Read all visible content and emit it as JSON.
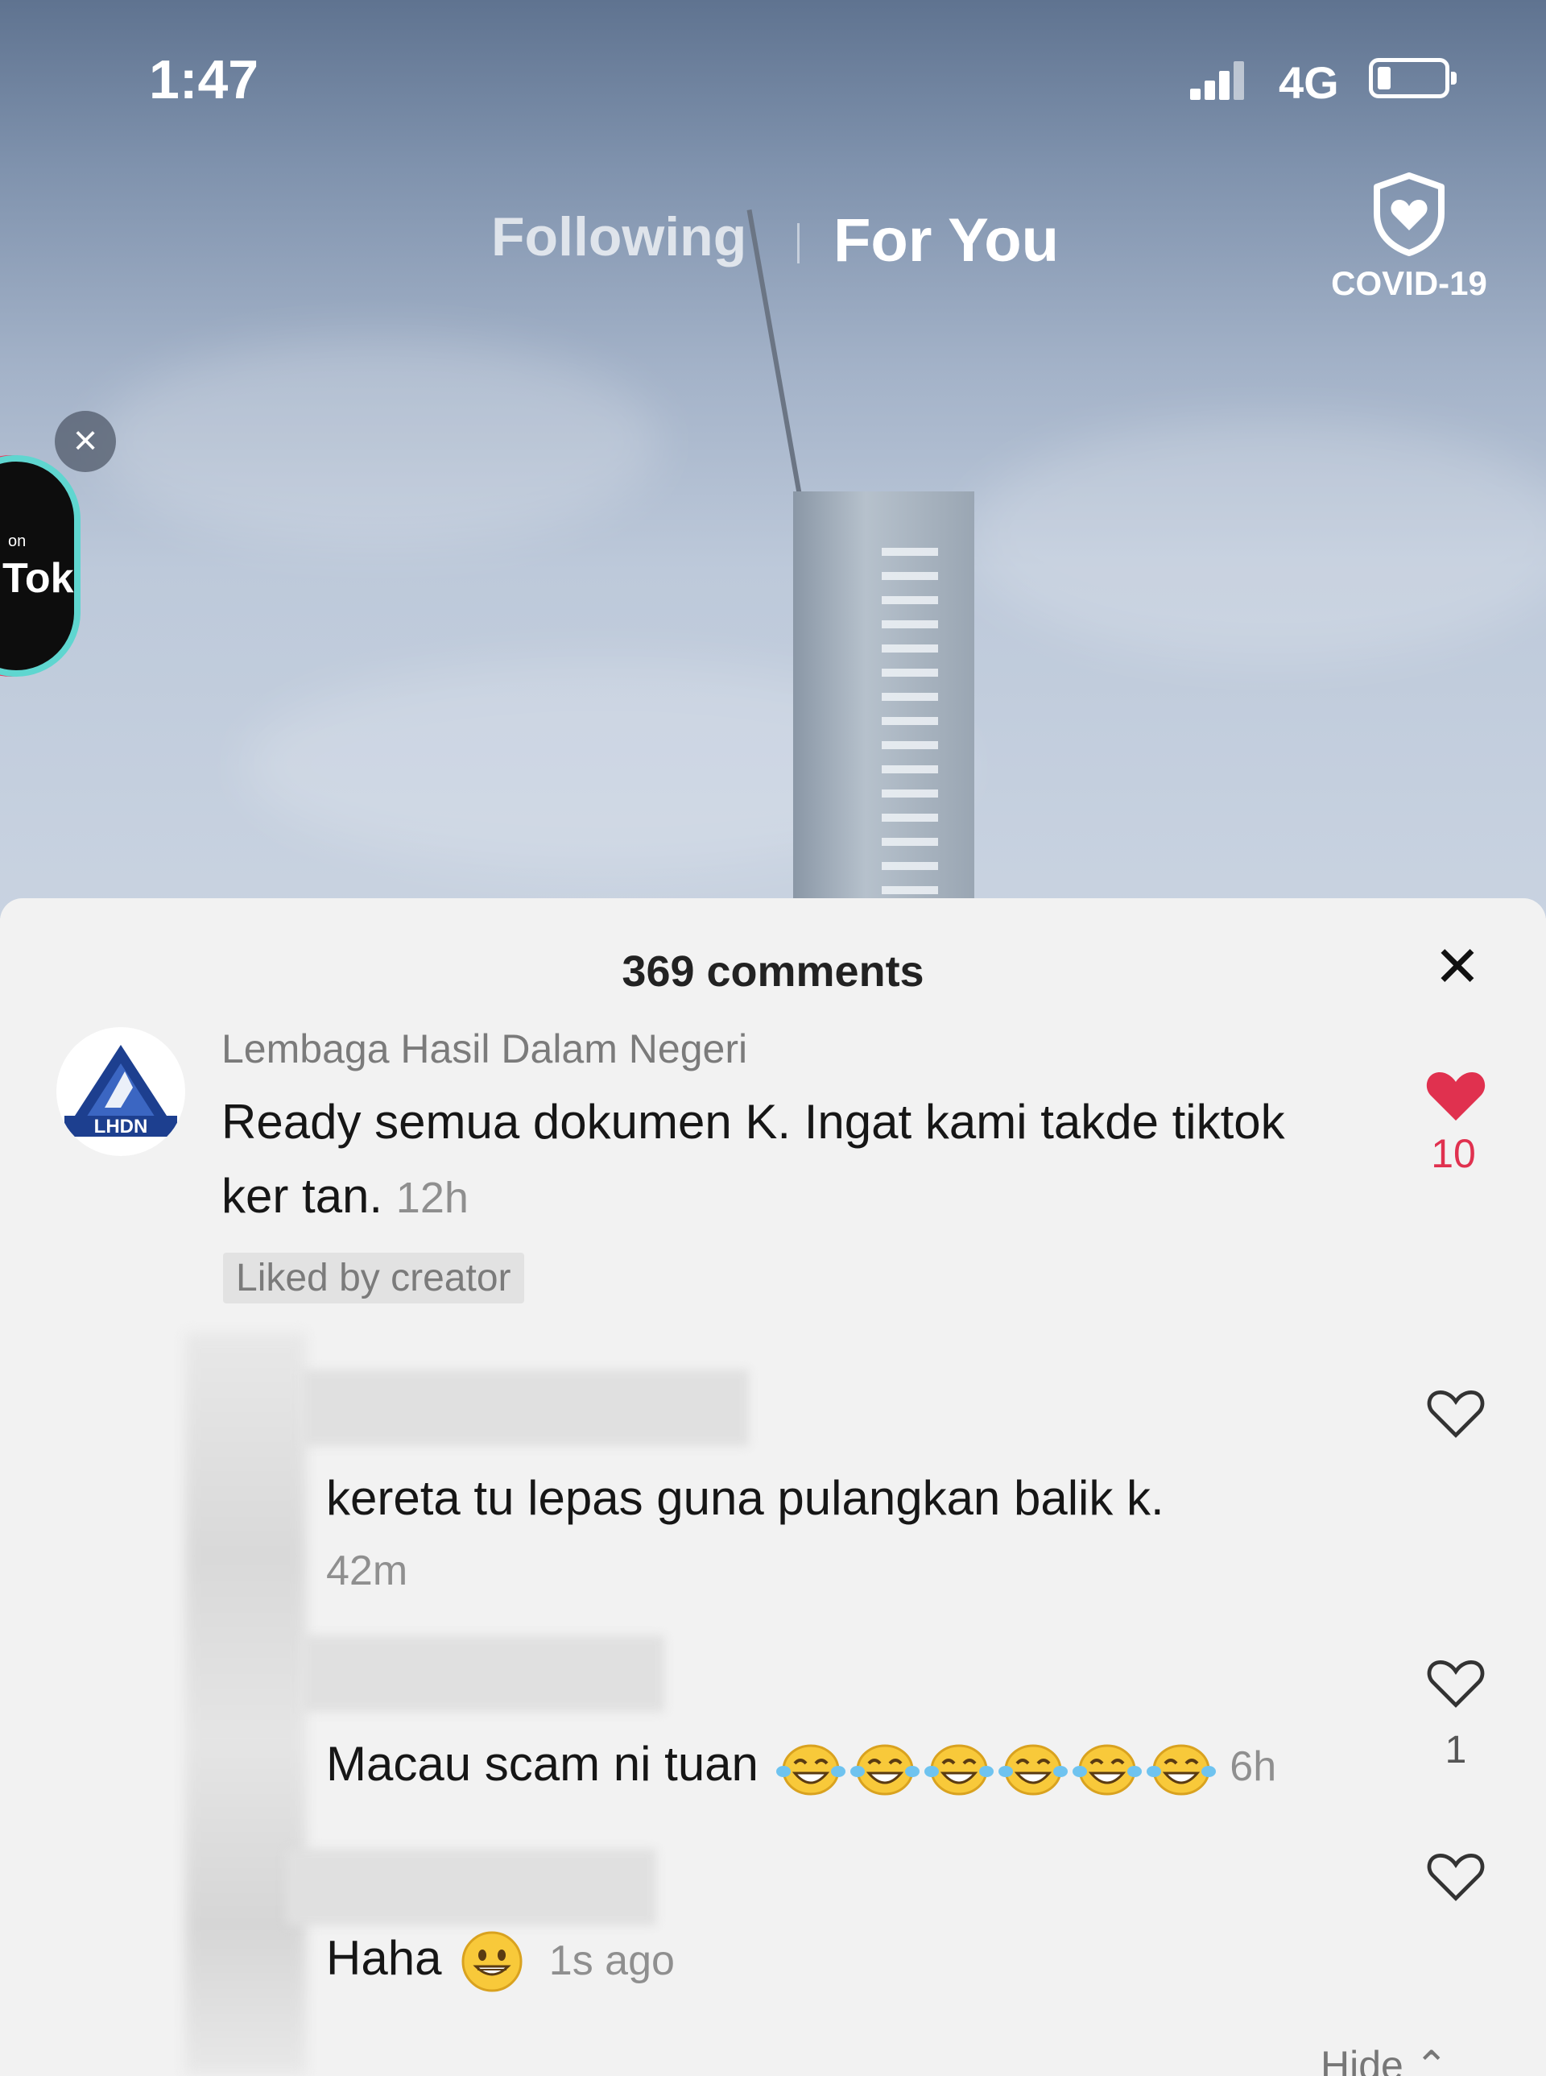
{
  "status_bar": {
    "time": "1:47",
    "network": "4G",
    "signal_bars": 4,
    "battery_level": 0.2
  },
  "feed_tabs": {
    "following": "Following",
    "for_you": "For You",
    "active": "For You"
  },
  "covid_button": {
    "label": "COVID-19",
    "icon": "shield-heart-icon"
  },
  "promo_badge": {
    "small_text": "on",
    "label": "Tok",
    "close_icon": "close-icon"
  },
  "comments": {
    "title": "369 comments",
    "close_icon": "close-icon",
    "main_comment": {
      "username": "Lembaga Hasil Dalam Negeri",
      "avatar_text": "LHDN",
      "text": "Ready semua dokumen K. Ingat kami takde tiktok ker tan.",
      "time": "12h",
      "badge": "Liked by creator",
      "likes": "10",
      "liked": true
    },
    "replies": [
      {
        "text": "kereta tu lepas guna pulangkan balik k.",
        "time": "42m",
        "likes": ""
      },
      {
        "text": "Macau scam ni tuan",
        "emoji": "face-with-tears-of-joy",
        "emoji_count": 6,
        "time": "6h",
        "likes": "1"
      },
      {
        "text": "Haha",
        "emoji": "grinning-face",
        "time": "1s ago",
        "likes": ""
      }
    ],
    "hide_label": "Hide"
  },
  "colors": {
    "like_red": "#e0314f",
    "sheet_bg": "#f2f2f2",
    "lhdn_blue": "#1d3f8f"
  }
}
